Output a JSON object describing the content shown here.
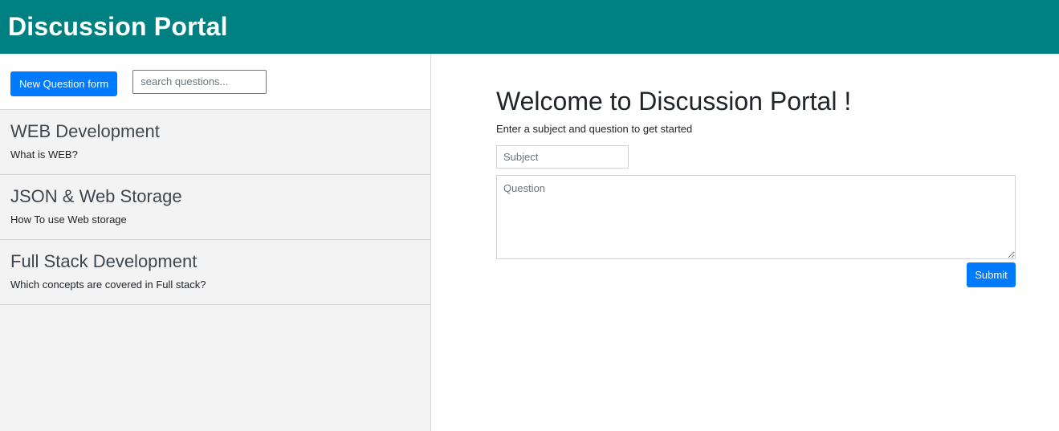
{
  "header": {
    "title": "Discussion Portal"
  },
  "sidebar": {
    "new_question_label": "New Question form",
    "search_placeholder": "search questions...",
    "questions": [
      {
        "subject": "WEB Development",
        "question": "What is WEB?"
      },
      {
        "subject": "JSON & Web Storage",
        "question": "How To use Web storage"
      },
      {
        "subject": "Full Stack Development",
        "question": "Which concepts are covered in Full stack?"
      }
    ]
  },
  "content": {
    "welcome_title": "Welcome to Discussion Portal !",
    "welcome_subtitle": "Enter a subject and question to get started",
    "subject_placeholder": "Subject",
    "question_placeholder": "Question",
    "submit_label": "Submit"
  },
  "colors": {
    "header_bg": "#008080",
    "button_bg": "#007bff",
    "sidebar_bg": "#f3f3f3"
  }
}
